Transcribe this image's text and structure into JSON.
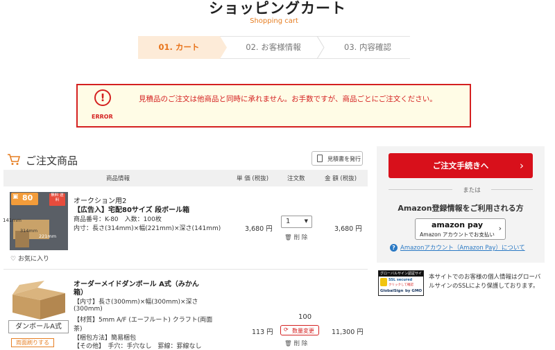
{
  "header": {
    "title": "ショッピングカート",
    "subtitle": "Shopping cart"
  },
  "steps": [
    {
      "label": "01. カート",
      "active": true
    },
    {
      "label": "02. お客様情報",
      "active": false
    },
    {
      "label": "03. 内容確認",
      "active": false
    }
  ],
  "error": {
    "icon_label": "ERROR",
    "message": "見積品のご注文は他商品と同時に承れません。お手数ですが、商品ごとにご注文ください。"
  },
  "cart": {
    "title": "ご注文商品",
    "quote_button": "見積書を発行",
    "columns": {
      "product": "商品情報",
      "unit_price": "単 価 (税抜)",
      "qty": "注文数",
      "amount": "金 額 (税抜)"
    },
    "items": [
      {
        "badge_size": "80",
        "badge_sub": "サイズ",
        "free_tag": "無料 送料",
        "image_dims": {
          "h": "141mm",
          "d": "314mm",
          "w": "221mm"
        },
        "favorite": "お気に入り",
        "name_line1": "オークション用2",
        "name_line2": "【広告入】宅配80サイズ 段ボール箱",
        "spec1": "商品番号：K-80　入数：100枚",
        "spec2": "内寸：長さ(314mm)×幅(221mm)×深さ(141mm)",
        "unit_price": "3,680 円",
        "qty": "1",
        "delete": "削 除",
        "amount": "3,680 円"
      },
      {
        "image_label": "ダンボールA式",
        "tag": "両面刷りする",
        "name_line1": "オーダーメイドダンボール A式（みかん",
        "name_line2": "箱）",
        "spec1": "【内寸】長さ(300mm)×幅(300mm)×深さ",
        "spec2": "(300mm)",
        "spec3": "【材質】5mm A/F (エーフルート) クラフト(両面",
        "spec4": "茶)",
        "spec5": "【梱包方法】簡易梱包",
        "spec6": "【その他】　手穴：手穴なし　罫線：罫線なし",
        "unit_price": "113 円",
        "qty": "100",
        "qty_change": "数量変更",
        "delete": "削 除",
        "amount": "11,300 円"
      }
    ]
  },
  "sidebar": {
    "order_button": "ご注文手続きへ",
    "or_text": "または",
    "amazon_title": "Amazon登録情報をご利用される方",
    "amazon_pay_logo": "amazon pay",
    "amazon_pay_sub": "Amazon アカウントでお支払い",
    "amazon_help": "Amazonアカウント（Amazon Pay）について",
    "globalsign_header": "グローバルサイン認証サイト",
    "globalsign_ssl": "SSL secured",
    "globalsign_sub": "クリックして確認",
    "globalsign_footer": "GlobalSign",
    "globalsign_brand": "by GMO",
    "security_text": "本サイトでのお客様の個人情報はグローバルサインのSSLにより保護しております。"
  },
  "colors": {
    "accent": "#e8731a",
    "error": "#d42020",
    "order_button": "#d8101b",
    "link": "#2a79c4"
  }
}
